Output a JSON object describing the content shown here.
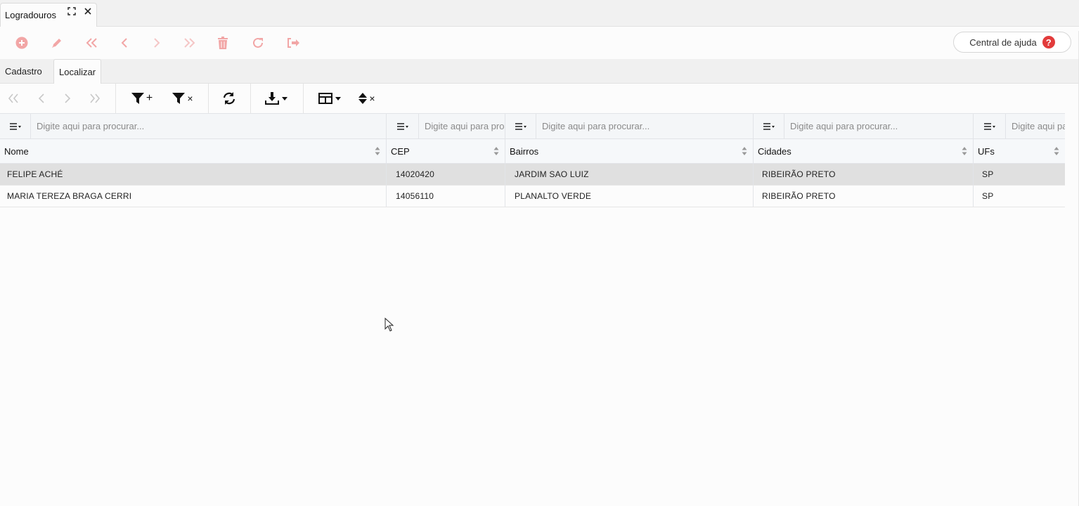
{
  "window": {
    "tab_label": "Logradouros",
    "expand_icon": "expand-icon",
    "close_icon": "close-icon"
  },
  "toolbar": {
    "actions": [
      "add-icon",
      "edit-icon",
      "first-icon",
      "previous-icon",
      "next-icon",
      "last-icon",
      "delete-icon",
      "refresh-icon",
      "exit-icon"
    ],
    "accent_color": "#f0a8a8",
    "help_label": "Central de ajuda",
    "help_icon_glyph": "?"
  },
  "tabs": {
    "cadastro": "Cadastro",
    "localizar": "Localizar"
  },
  "grid_toolbar": {
    "plus": "+",
    "times": "×"
  },
  "grid": {
    "filter_placeholders": {
      "nome": "Digite aqui para procurar...",
      "cep": "Digite aqui para procurar...",
      "bairros": "Digite aqui para procurar...",
      "cidades": "Digite aqui para procurar...",
      "ufs": "Digite aqui para procurar..."
    },
    "columns": [
      "Nome",
      "CEP",
      "Bairros",
      "Cidades",
      "UFs"
    ],
    "rows": [
      {
        "nome": "FELIPE ACHÉ",
        "cep": "14020420",
        "bairro": "JARDIM SAO LUIZ",
        "cidade": "RIBEIRÃO PRETO",
        "uf": "SP"
      },
      {
        "nome": "MARIA TEREZA BRAGA CERRI",
        "cep": "14056110",
        "bairro": "PLANALTO VERDE",
        "cidade": "RIBEIRÃO PRETO",
        "uf": "SP"
      }
    ]
  }
}
